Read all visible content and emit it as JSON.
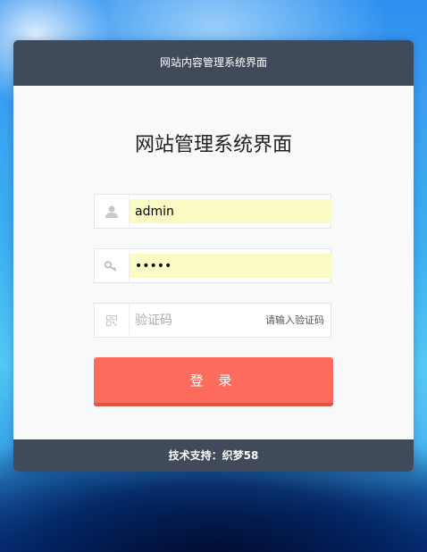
{
  "header": {
    "title": "网站内容管理系统界面"
  },
  "login": {
    "title": "网站管理系统界面",
    "username": {
      "icon": "user-icon",
      "value": "admin"
    },
    "password": {
      "icon": "key-icon",
      "value": "admin"
    },
    "captcha": {
      "icon": "qr-code-icon",
      "placeholder": "验证码",
      "link_label": "请输入验证码"
    },
    "submit_label": "登 录"
  },
  "footer": {
    "text": "技术支持：织梦58"
  },
  "colors": {
    "header_bg": "#414a5a",
    "button_bg": "#fe6c5e",
    "autofill_bg": "#fafcc3"
  }
}
